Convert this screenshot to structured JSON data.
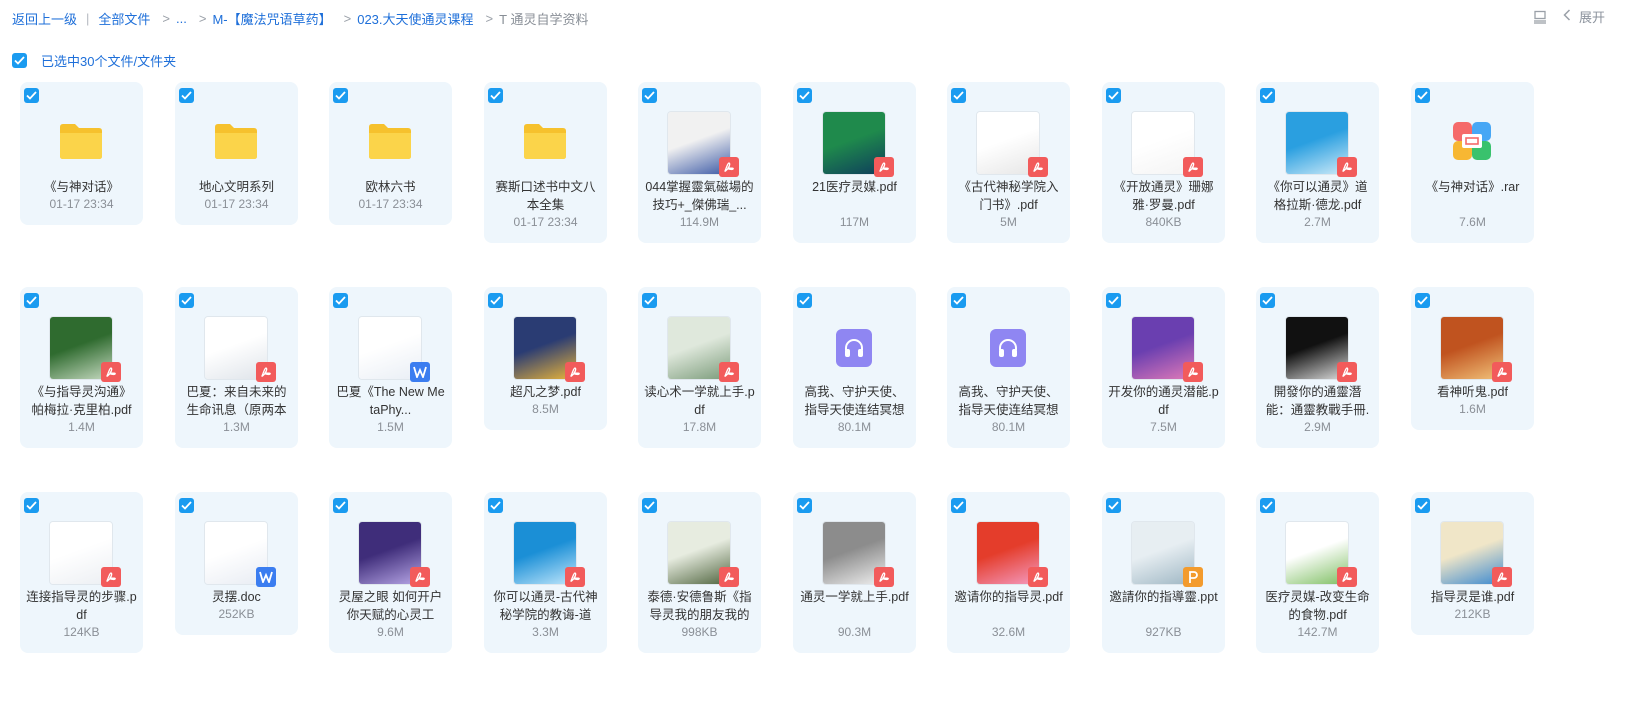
{
  "breadcrumb": {
    "back": "返回上一级",
    "all_files": "全部文件",
    "ellipsis": "...",
    "folder1": "M-【魔法咒语草药】",
    "folder2": "023.大天使通灵课程",
    "current": "T 通灵自学资料"
  },
  "toolbar": {
    "expand_label": "展开"
  },
  "selection": {
    "label": "已选中30个文件/文件夹"
  },
  "colors": {
    "accent": "#1e6fd9",
    "checkbox": "#1a9bf0",
    "card_bg": "#eef6fc",
    "pdf": "#f25b5b",
    "doc": "#3b7df0",
    "ppt": "#f39b2d"
  },
  "files": [
    {
      "name": "《与神对话》",
      "meta": "01-17 23:34",
      "kind": "folder"
    },
    {
      "name": "地心文明系列",
      "meta": "01-17 23:34",
      "kind": "folder"
    },
    {
      "name": "欧林六书",
      "meta": "01-17 23:34",
      "kind": "folder"
    },
    {
      "name": "赛斯口述书中文八本全集",
      "meta": "01-17 23:34",
      "kind": "folder"
    },
    {
      "name": "044掌握靈氣磁場的技巧+_傑佛瑞_...",
      "meta": "114.9M",
      "kind": "pdf",
      "cover": [
        "#f1f1f1",
        "#3c5aa6"
      ]
    },
    {
      "name": "21医疗灵媒.pdf",
      "meta": "117M",
      "kind": "pdf",
      "cover": [
        "#1f8a4c",
        "#0e3d5c"
      ]
    },
    {
      "name": "《古代神秘学院入门书》.pdf",
      "meta": "5M",
      "kind": "pdf",
      "cover": [
        "#ffffff",
        "#e6e6e6"
      ]
    },
    {
      "name": "《开放通灵》珊娜雅·罗曼.pdf",
      "meta": "840KB",
      "kind": "pdf",
      "cover": [
        "#ffffff",
        "#f4f4f4"
      ]
    },
    {
      "name": "《你可以通灵》道格拉斯·德龙.pdf",
      "meta": "2.7M",
      "kind": "pdf",
      "cover": [
        "#2a9fe0",
        "#cdeaf8"
      ]
    },
    {
      "name": "《与神对话》.rar",
      "meta": "7.6M",
      "kind": "rar"
    },
    {
      "name": "《与指导灵沟通》帕梅拉·克里柏.pdf",
      "meta": "1.4M",
      "kind": "pdf",
      "cover": [
        "#2f6b2f",
        "#c5d9c0"
      ]
    },
    {
      "name": "巴夏：来自未来的生命讯息（原两本",
      "meta": "1.3M",
      "kind": "pdf",
      "cover": [
        "#ffffff",
        "#dfe4ea"
      ]
    },
    {
      "name": "巴夏《The New MetaPhy...",
      "meta": "1.5M",
      "kind": "doc",
      "cover": [
        "#ffffff",
        "#e9eef5"
      ]
    },
    {
      "name": "超凡之梦.pdf",
      "meta": "8.5M",
      "kind": "pdf",
      "cover": [
        "#2a3c73",
        "#e9b53a"
      ]
    },
    {
      "name": "读心术一学就上手.pdf",
      "meta": "17.8M",
      "kind": "pdf",
      "cover": [
        "#dfe8dc",
        "#7b9b7a"
      ]
    },
    {
      "name": "高我、守护天使、指导天使连结冥想",
      "meta": "80.1M",
      "kind": "audio"
    },
    {
      "name": "高我、守护天使、指导天使连结冥想",
      "meta": "80.1M",
      "kind": "audio"
    },
    {
      "name": "开发你的通灵潜能.pdf",
      "meta": "7.5M",
      "kind": "pdf",
      "cover": [
        "#6a3fb0",
        "#e07ab8"
      ]
    },
    {
      "name": "開發你的通靈潛能：通靈教戰手冊.",
      "meta": "2.9M",
      "kind": "pdf",
      "cover": [
        "#111111",
        "#dddddd"
      ]
    },
    {
      "name": "看神听鬼.pdf",
      "meta": "1.6M",
      "kind": "pdf",
      "cover": [
        "#c0531f",
        "#f1c27a"
      ]
    },
    {
      "name": "连接指导灵的步骤.pdf",
      "meta": "124KB",
      "kind": "pdf",
      "cover": [
        "#ffffff",
        "#eceff3"
      ]
    },
    {
      "name": "灵摆.doc",
      "meta": "252KB",
      "kind": "doc",
      "cover": [
        "#ffffff",
        "#e8ecf3"
      ]
    },
    {
      "name": "灵屋之眼 如何开户你天赋的心灵工",
      "meta": "9.6M",
      "kind": "pdf",
      "cover": [
        "#3f2d7a",
        "#b7a6e6"
      ]
    },
    {
      "name": "你可以通灵-古代神秘学院的教诲-道",
      "meta": "3.3M",
      "kind": "pdf",
      "cover": [
        "#1b8fd6",
        "#bfe6fb"
      ]
    },
    {
      "name": "泰德·安德鲁斯《指导灵我的朋友我的",
      "meta": "998KB",
      "kind": "pdf",
      "cover": [
        "#e7ece0",
        "#50653f"
      ]
    },
    {
      "name": "通灵一学就上手.pdf",
      "meta": "90.3M",
      "kind": "pdf",
      "cover": [
        "#8c8c8c",
        "#efefef"
      ]
    },
    {
      "name": "邀请你的指导灵.pdf",
      "meta": "32.6M",
      "kind": "pdf",
      "cover": [
        "#e43d2b",
        "#f49ac0"
      ]
    },
    {
      "name": "邀請你的指導靈.ppt",
      "meta": "927KB",
      "kind": "ppt",
      "cover": [
        "#e7eef2",
        "#9fb7c4"
      ]
    },
    {
      "name": "医疗灵媒-改变生命的食物.pdf",
      "meta": "142.7M",
      "kind": "pdf",
      "cover": [
        "#ffffff",
        "#7fbf63"
      ]
    },
    {
      "name": "指导灵是谁.pdf",
      "meta": "212KB",
      "kind": "pdf",
      "cover": [
        "#f0e6c8",
        "#3d8ad0"
      ]
    }
  ]
}
